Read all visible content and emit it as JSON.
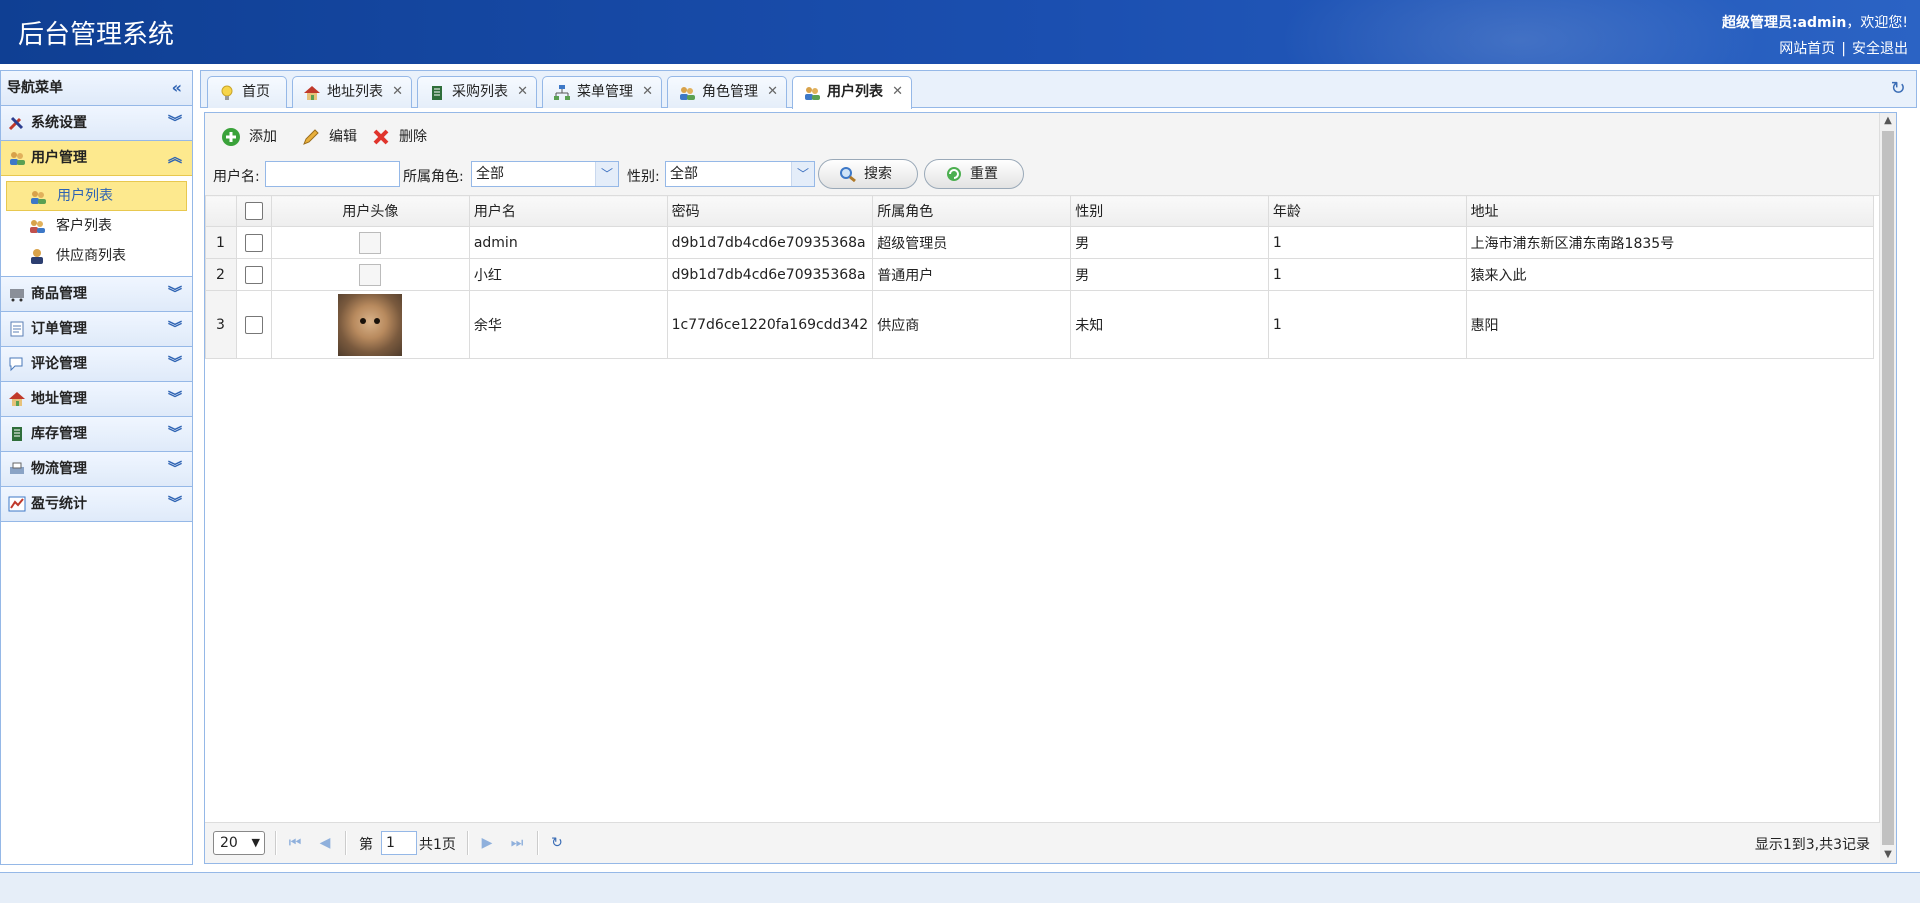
{
  "header": {
    "title": "后台管理系统",
    "welcome_role": "超级管理员:admin",
    "welcome_text": "，欢迎您!",
    "link_home": "网站首页",
    "link_sep": "|",
    "link_logout": "安全退出"
  },
  "sidebar": {
    "title": "导航菜单",
    "collapse_icon": "«",
    "panels": [
      {
        "label": "系统设置",
        "icon": "tools-icon"
      },
      {
        "label": "用户管理",
        "icon": "users-icon"
      },
      {
        "label": "商品管理",
        "icon": "cart-icon"
      },
      {
        "label": "订单管理",
        "icon": "order-icon"
      },
      {
        "label": "评论管理",
        "icon": "comment-icon"
      },
      {
        "label": "地址管理",
        "icon": "house-icon"
      },
      {
        "label": "库存管理",
        "icon": "stock-icon"
      },
      {
        "label": "物流管理",
        "icon": "printer-icon"
      },
      {
        "label": "盈亏统计",
        "icon": "chart-icon"
      }
    ],
    "user_items": [
      {
        "label": "用户列表"
      },
      {
        "label": "客户列表"
      },
      {
        "label": "供应商列表"
      }
    ]
  },
  "tabs": [
    {
      "label": "首页"
    },
    {
      "label": "地址列表"
    },
    {
      "label": "采购列表"
    },
    {
      "label": "菜单管理"
    },
    {
      "label": "角色管理"
    },
    {
      "label": "用户列表"
    }
  ],
  "toolbar": {
    "add_label": "添加",
    "edit_label": "编辑",
    "delete_label": "删除"
  },
  "filters": {
    "username_label": "用户名:",
    "username_value": "",
    "role_label": "所属角色:",
    "role_value": "全部",
    "gender_label": "性别:",
    "gender_value": "全部",
    "search_label": "搜索",
    "reset_label": "重置"
  },
  "grid": {
    "columns": [
      "用户头像",
      "用户名",
      "密码",
      "所属角色",
      "性别",
      "年龄",
      "地址"
    ],
    "rows": [
      {
        "num": "1",
        "username": "admin",
        "password": "d9b1d7db4cd6e70935368a",
        "role": "超级管理员",
        "gender": "男",
        "age": "1",
        "address": "上海市浦东新区浦东南路1835号"
      },
      {
        "num": "2",
        "username": "小红",
        "password": "d9b1d7db4cd6e70935368a",
        "role": "普通用户",
        "gender": "男",
        "age": "1",
        "address": "猿来入此"
      },
      {
        "num": "3",
        "username": "余华",
        "password": "1c77d6ce1220fa169cdd342",
        "role": "供应商",
        "gender": "未知",
        "age": "1",
        "address": "惠阳"
      }
    ]
  },
  "pager": {
    "page_size": "20",
    "page_prefix": "第",
    "page_value": "1",
    "page_suffix": "共1页",
    "summary": "显示1到3,共3记录"
  }
}
